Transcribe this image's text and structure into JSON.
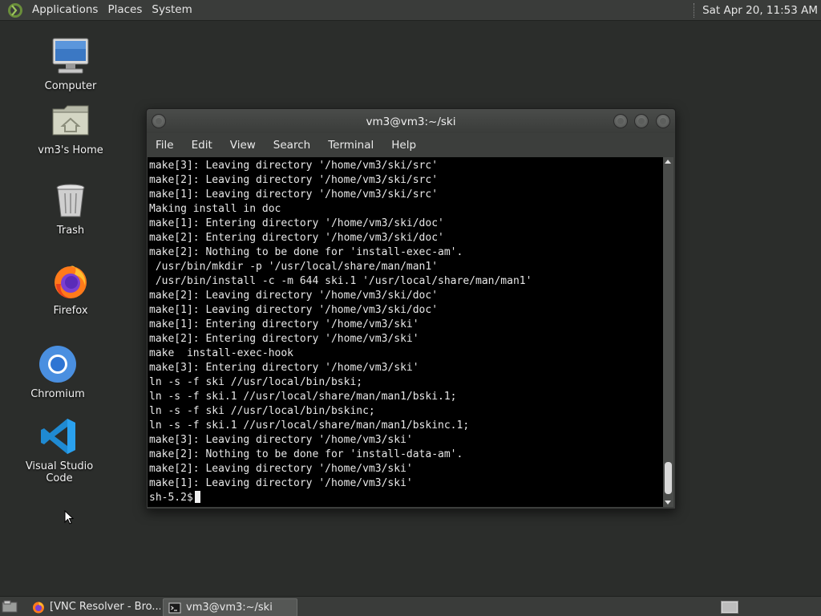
{
  "top_panel": {
    "menus": [
      "Applications",
      "Places",
      "System"
    ],
    "clock": "Sat Apr 20, 11:53 AM"
  },
  "desktop": {
    "icons": [
      {
        "label": "Computer",
        "icon": "computer-icon"
      },
      {
        "label": "vm3's Home",
        "icon": "home-folder-icon"
      },
      {
        "label": "Trash",
        "icon": "trash-icon"
      },
      {
        "label": "Firefox",
        "icon": "firefox-icon"
      },
      {
        "label": "Chromium",
        "icon": "chromium-icon"
      },
      {
        "label": "Visual Studio Code",
        "icon": "vscode-icon"
      }
    ]
  },
  "window": {
    "title": "vm3@vm3:~/ski",
    "menu": [
      "File",
      "Edit",
      "View",
      "Search",
      "Terminal",
      "Help"
    ],
    "terminal_lines": [
      "make[3]: Leaving directory '/home/vm3/ski/src'",
      "make[2]: Leaving directory '/home/vm3/ski/src'",
      "make[1]: Leaving directory '/home/vm3/ski/src'",
      "Making install in doc",
      "make[1]: Entering directory '/home/vm3/ski/doc'",
      "make[2]: Entering directory '/home/vm3/ski/doc'",
      "make[2]: Nothing to be done for 'install-exec-am'.",
      " /usr/bin/mkdir -p '/usr/local/share/man/man1'",
      " /usr/bin/install -c -m 644 ski.1 '/usr/local/share/man/man1'",
      "make[2]: Leaving directory '/home/vm3/ski/doc'",
      "make[1]: Leaving directory '/home/vm3/ski/doc'",
      "make[1]: Entering directory '/home/vm3/ski'",
      "make[2]: Entering directory '/home/vm3/ski'",
      "make  install-exec-hook",
      "make[3]: Entering directory '/home/vm3/ski'",
      "ln -s -f ski //usr/local/bin/bski;",
      "ln -s -f ski.1 //usr/local/share/man/man1/bski.1;",
      "ln -s -f ski //usr/local/bin/bskinc;",
      "ln -s -f ski.1 //usr/local/share/man/man1/bskinc.1;",
      "make[3]: Leaving directory '/home/vm3/ski'",
      "make[2]: Nothing to be done for 'install-data-am'.",
      "make[2]: Leaving directory '/home/vm3/ski'",
      "make[1]: Leaving directory '/home/vm3/ski'"
    ],
    "prompt": "sh-5.2$"
  },
  "taskbar": {
    "tasks": [
      {
        "label": "[VNC Resolver - Bro...",
        "icon": "firefox-icon",
        "active": false
      },
      {
        "label": "vm3@vm3:~/ski",
        "icon": "terminal-icon",
        "active": true
      }
    ]
  },
  "colors": {
    "panel": "#3a3c3a",
    "desktop": "#2b2d2b",
    "terminal_bg": "#000000",
    "terminal_fg": "#e8e8e8"
  }
}
